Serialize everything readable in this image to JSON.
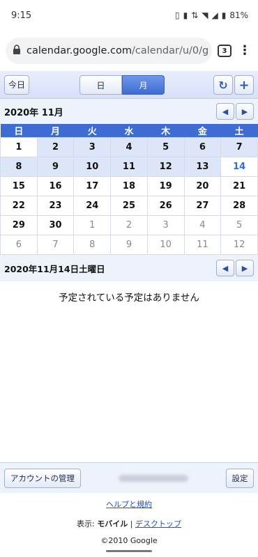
{
  "status": {
    "time": "9:15",
    "battery": "81%"
  },
  "browser": {
    "url_domain": "calendar.google.com",
    "url_path": "/calendar/u/0/g",
    "tab_count": "3"
  },
  "toolbar": {
    "today_label": "今日",
    "day_label": "日",
    "month_label": "月",
    "refresh_icon": "refresh-icon",
    "add_icon": "plus-icon"
  },
  "month": {
    "title": "2020年 11月",
    "prev": "◀",
    "next": "▶"
  },
  "calendar": {
    "weekdays": [
      "日",
      "月",
      "火",
      "水",
      "木",
      "金",
      "土"
    ],
    "weeks": [
      [
        "1",
        "2",
        "3",
        "4",
        "5",
        "6",
        "7"
      ],
      [
        "8",
        "9",
        "10",
        "11",
        "12",
        "13",
        "14"
      ],
      [
        "15",
        "16",
        "17",
        "18",
        "19",
        "20",
        "21"
      ],
      [
        "22",
        "23",
        "24",
        "25",
        "26",
        "27",
        "28"
      ],
      [
        "29",
        "30",
        "1",
        "2",
        "3",
        "4",
        "5"
      ],
      [
        "6",
        "7",
        "8",
        "9",
        "10",
        "11",
        "12"
      ]
    ],
    "selected_date": "14"
  },
  "day": {
    "title": "2020年11月14日土曜日",
    "prev": "◀",
    "next": "▶",
    "empty_message": "予定されている予定はありません"
  },
  "footer": {
    "account_button": "アカウントの管理",
    "settings_button": "設定",
    "help_link": "ヘルプと規約",
    "view_prefix": "表示:",
    "view_mobile": "モバイル",
    "view_separator": "|",
    "view_desktop": "デスクトップ",
    "copyright": "©2010 Google"
  }
}
